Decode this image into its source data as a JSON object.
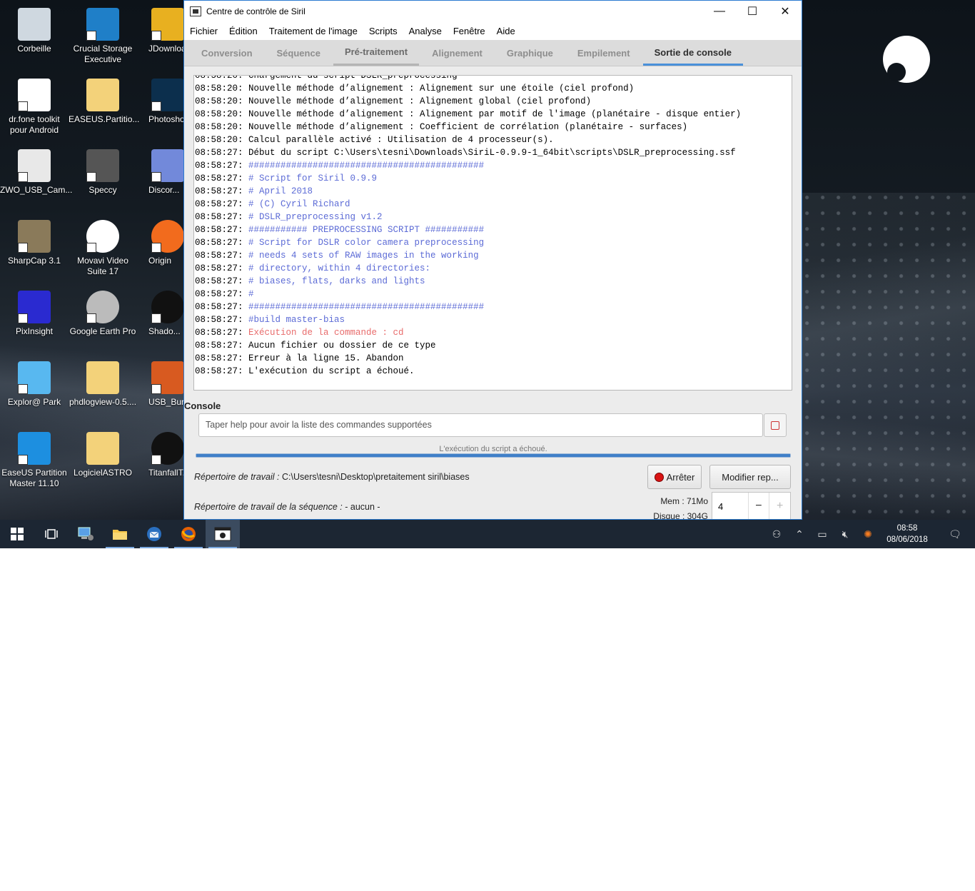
{
  "desktop": {
    "icons": [
      {
        "label": "Corbeille",
        "icon": "recycle-bin-icon"
      },
      {
        "label": "Crucial Storage Executive",
        "icon": "crucial-icon"
      },
      {
        "label": "JDownload...",
        "icon": "jdownloader-icon"
      },
      {
        "label": "dr.fone toolkit pour Android",
        "icon": "drfone-icon"
      },
      {
        "label": "EASEUS.Partitio...",
        "icon": "folder-icon"
      },
      {
        "label": "Photosho... Raccour...",
        "icon": "photoshop-icon"
      },
      {
        "label": "ZWO_USB_Cam...",
        "icon": "zwo-icon"
      },
      {
        "label": "Speccy",
        "icon": "speccy-icon"
      },
      {
        "label": "Discor...",
        "icon": "discord-icon"
      },
      {
        "label": "SharpCap 3.1",
        "icon": "sharpcap-icon"
      },
      {
        "label": "Movavi Video Suite 17",
        "icon": "movavi-icon"
      },
      {
        "label": "Origin",
        "icon": "origin-icon"
      },
      {
        "label": "PixInsight",
        "icon": "pixinsight-icon"
      },
      {
        "label": "Google Earth Pro",
        "icon": "google-earth-icon"
      },
      {
        "label": "Shado...",
        "icon": "shadowplay-icon"
      },
      {
        "label": "Explor@ Park",
        "icon": "explor-park-icon"
      },
      {
        "label": "phdlogview-0.5....",
        "icon": "folder-icon"
      },
      {
        "label": "USB_Burni...",
        "icon": "usb-burning-icon"
      },
      {
        "label": "EaseUS Partition Master 11.10",
        "icon": "easeus-icon"
      },
      {
        "label": "LogicielASTRO",
        "icon": "folder-icon"
      },
      {
        "label": "TitanfallT...",
        "icon": "titanfall-icon"
      }
    ]
  },
  "window": {
    "title": "Centre de contrôle de Siril",
    "controls": {
      "minimize": "—",
      "maximize": "☐",
      "close": "✕"
    },
    "menu": [
      "Fichier",
      "Édition",
      "Traitement de l'image",
      "Scripts",
      "Analyse",
      "Fenêtre",
      "Aide"
    ],
    "tabs": [
      "Conversion",
      "Séquence",
      "Pré-traitement",
      "Alignement",
      "Graphique",
      "Empilement",
      "Sortie de console"
    ],
    "active_tab": "Sortie de console",
    "console_lines": [
      {
        "ts": "08:58:20:",
        "msg": " Chargement du script DSLR_preprocessing",
        "kind": "cut"
      },
      {
        "ts": "08:58:20:",
        "msg": " Nouvelle méthode d’alignement : Alignement sur une étoile (ciel profond)",
        "kind": "b"
      },
      {
        "ts": "08:58:20:",
        "msg": " Nouvelle méthode d’alignement : Alignement global (ciel profond)",
        "kind": "b"
      },
      {
        "ts": "08:58:20:",
        "msg": " Nouvelle méthode d’alignement : Alignement par motif de l'image (planétaire - disque entier)",
        "kind": "b"
      },
      {
        "ts": "08:58:20:",
        "msg": " Nouvelle méthode d’alignement : Coefficient de corrélation (planétaire - surfaces)",
        "kind": "b"
      },
      {
        "ts": "08:58:20:",
        "msg": " Calcul parallèle activé : Utilisation de 4 processeur(s).",
        "kind": "b"
      },
      {
        "ts": "08:58:27:",
        "msg": " Début du script C:\\Users\\tesni\\Downloads\\SiriL-0.9.9-1_64bit\\scripts\\DSLR_preprocessing.ssf",
        "kind": "b"
      },
      {
        "ts": "08:58:27:",
        "msg": " ############################################",
        "kind": "s"
      },
      {
        "ts": "08:58:27:",
        "msg": " # Script for Siril 0.9.9",
        "kind": "s"
      },
      {
        "ts": "08:58:27:",
        "msg": " # April 2018",
        "kind": "s"
      },
      {
        "ts": "08:58:27:",
        "msg": " # (C) Cyril Richard",
        "kind": "s"
      },
      {
        "ts": "08:58:27:",
        "msg": " # DSLR_preprocessing v1.2",
        "kind": "s"
      },
      {
        "ts": "08:58:27:",
        "msg": " ########### PREPROCESSING SCRIPT ###########",
        "kind": "s"
      },
      {
        "ts": "08:58:27:",
        "msg": " # Script for DSLR color camera preprocessing",
        "kind": "s"
      },
      {
        "ts": "08:58:27:",
        "msg": " # needs 4 sets of RAW images in the working",
        "kind": "s"
      },
      {
        "ts": "08:58:27:",
        "msg": " # directory, within 4 directories:",
        "kind": "s"
      },
      {
        "ts": "08:58:27:",
        "msg": " # biases, flats, darks and lights",
        "kind": "s"
      },
      {
        "ts": "08:58:27:",
        "msg": " #",
        "kind": "s"
      },
      {
        "ts": "08:58:27:",
        "msg": " ############################################",
        "kind": "s"
      },
      {
        "ts": "08:58:27:",
        "msg": " #build master-bias",
        "kind": "s"
      },
      {
        "ts": "08:58:27:",
        "msg": " Exécution de la commande : cd",
        "kind": "r"
      },
      {
        "ts": "08:58:27:",
        "msg": " Aucun fichier ou dossier de ce type",
        "kind": "b"
      },
      {
        "ts": "08:58:27:",
        "msg": " Erreur à la ligne 15. Abandon",
        "kind": "b"
      },
      {
        "ts": "08:58:27:",
        "msg": " L'exécution du script a échoué.",
        "kind": "b"
      }
    ],
    "console_label": "Console",
    "command_placeholder": "Taper help pour avoir la liste des commandes supportées",
    "status_text": "L'exécution du script a échoué.",
    "progress": 1.0,
    "workdir_label": "Répertoire de travail :",
    "workdir_value": "C:\\Users\\tesni\\Desktop\\pretaitement siril\\biases",
    "seqdir_label": "Répertoire de travail de la séquence :",
    "seqdir_value": "- aucun -",
    "stop_button": "Arrêter",
    "modify_button": "Modifier rep...",
    "mem": "Mem : 71Mo",
    "disk": "Disque : 304G",
    "threads_value": "4",
    "minus": "−",
    "plus": "+"
  },
  "taskbar": {
    "items": [
      "start-icon",
      "task-view-icon",
      "network-computer-icon",
      "file-explorer-icon",
      "thunderbird-icon",
      "firefox-icon",
      "siril-icon"
    ],
    "time": "08:58",
    "date": "08/06/2018"
  }
}
